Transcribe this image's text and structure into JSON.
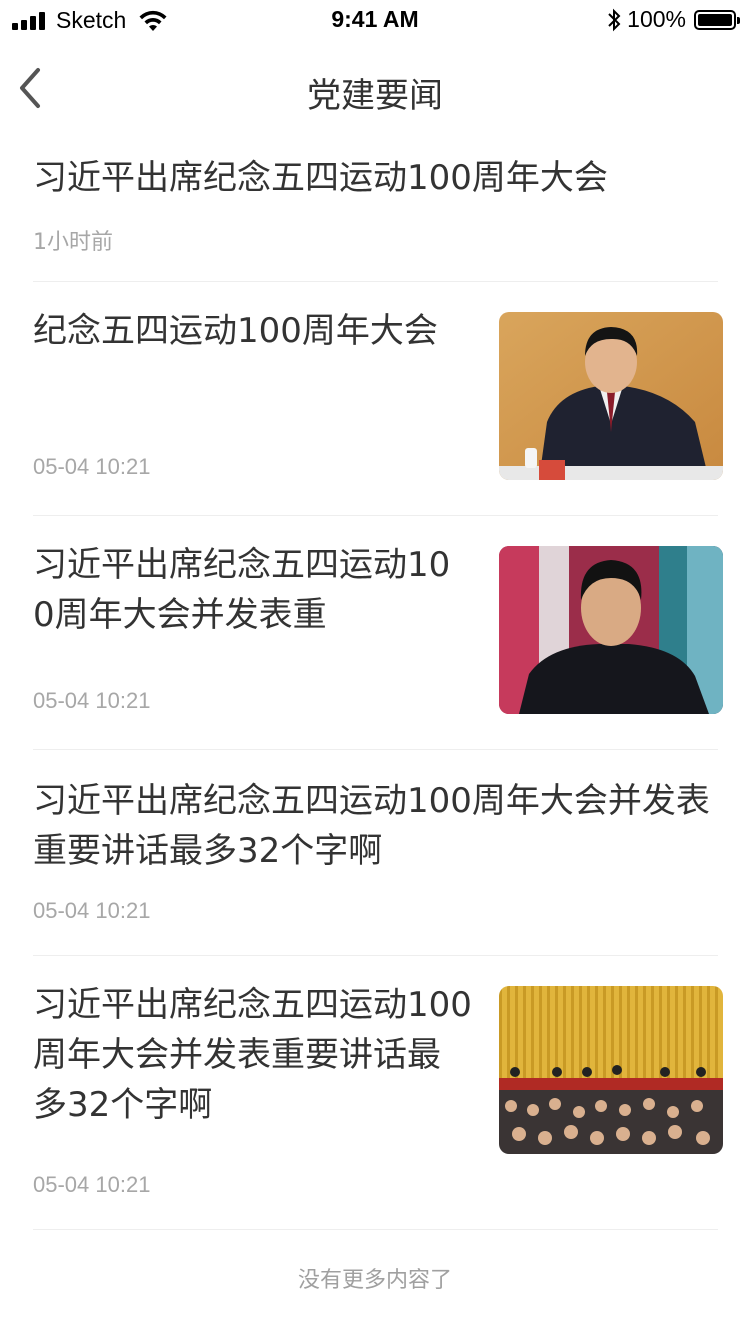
{
  "status_bar": {
    "carrier": "Sketch",
    "time": "9:41 AM",
    "battery": "100%"
  },
  "nav": {
    "title": "党建要闻",
    "back_icon": "chevron-left-icon"
  },
  "news": [
    {
      "title": "习近平出席纪念五四运动100周年大会",
      "time": "1小时前",
      "has_image": false
    },
    {
      "title": "纪念五四运动100周年大会",
      "time": "05-04 10:21",
      "has_image": true
    },
    {
      "title": "习近平出席纪念五四运动100周年大会并发表重",
      "time": "05-04 10:21",
      "has_image": true
    },
    {
      "title": "习近平出席纪念五四运动100周年大会并发表重要讲话最多32个字啊",
      "time": "05-04 10:21",
      "has_image": false
    },
    {
      "title": "习近平出席纪念五四运动100周年大会并发表重要讲话最多32个字啊",
      "time": "05-04 10:21",
      "has_image": true
    }
  ],
  "footer": {
    "note": "没有更多内容了"
  }
}
